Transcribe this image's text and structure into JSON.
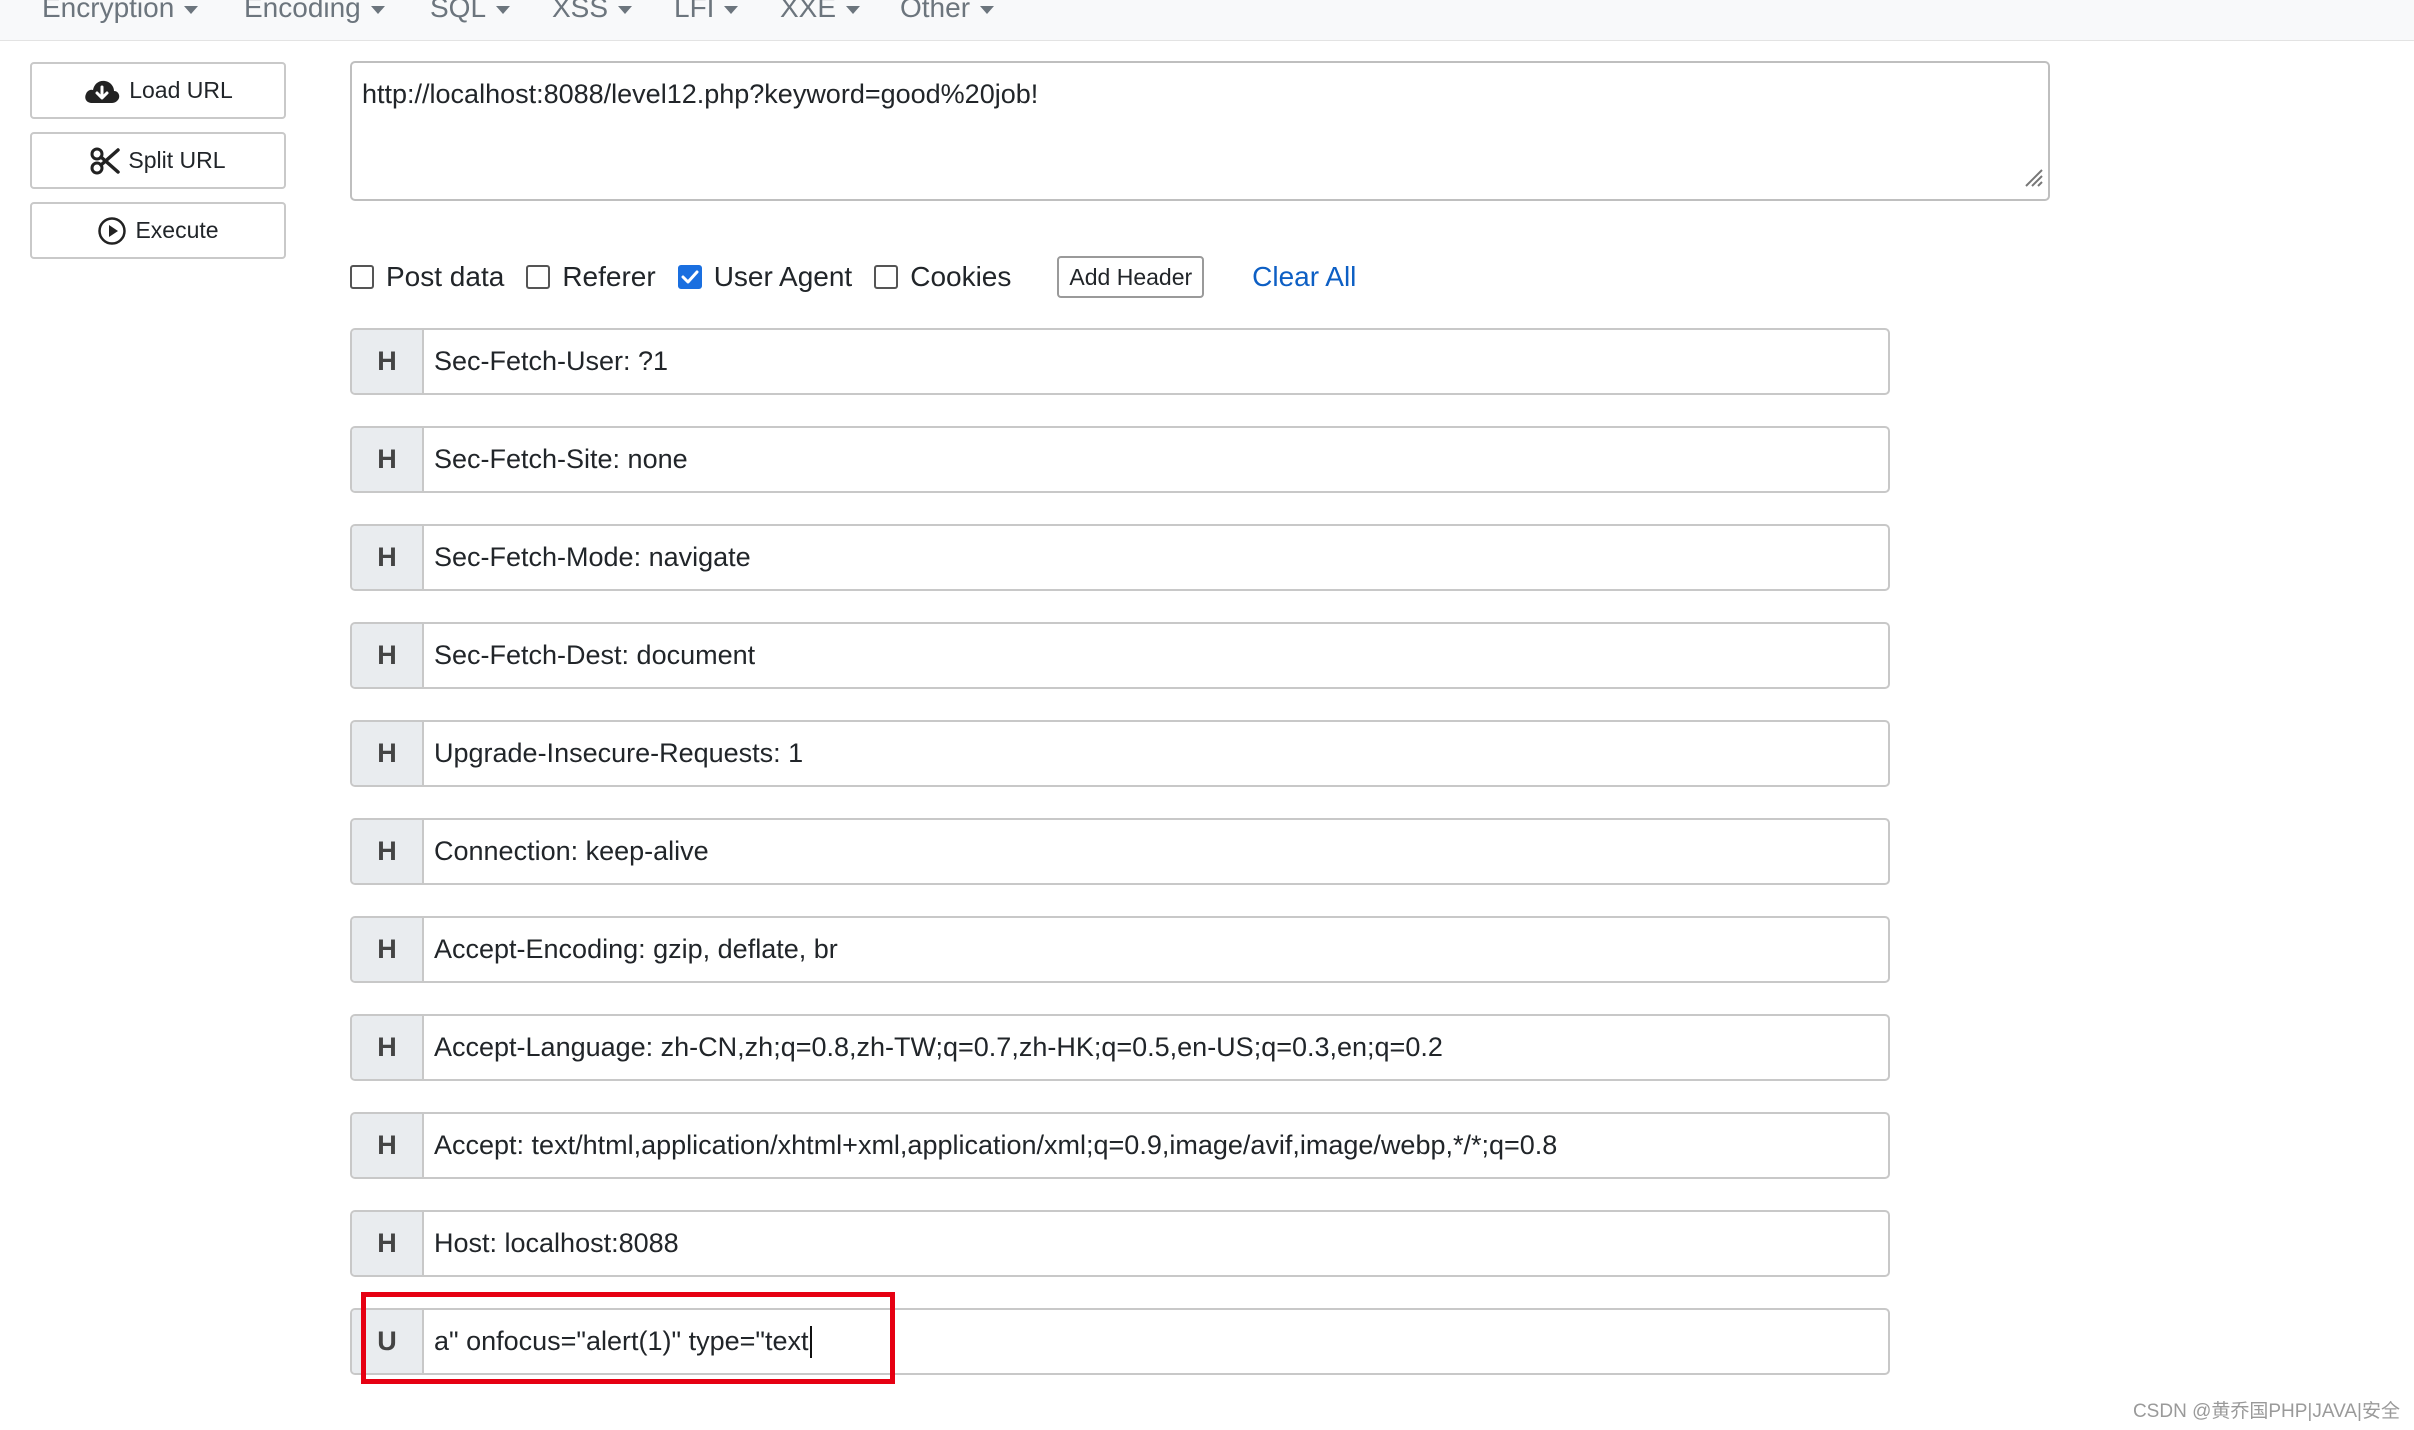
{
  "menu": [
    {
      "label": "Encryption"
    },
    {
      "label": "Encoding"
    },
    {
      "label": "SQL"
    },
    {
      "label": "XSS"
    },
    {
      "label": "LFI"
    },
    {
      "label": "XXE"
    },
    {
      "label": "Other"
    }
  ],
  "sidebar": {
    "load_url": "Load URL",
    "split_url": "Split URL",
    "execute": "Execute"
  },
  "url": {
    "value": "http://localhost:8088/level12.php?keyword=good%20job!"
  },
  "options": {
    "post_data": {
      "label": "Post data",
      "checked": false
    },
    "referer": {
      "label": "Referer",
      "checked": false
    },
    "user_agent": {
      "label": "User Agent",
      "checked": true
    },
    "cookies": {
      "label": "Cookies",
      "checked": false
    },
    "add_header": "Add Header",
    "clear_all": "Clear All"
  },
  "headers": [
    {
      "tag": "H",
      "value": "Sec-Fetch-User: ?1"
    },
    {
      "tag": "H",
      "value": "Sec-Fetch-Site: none"
    },
    {
      "tag": "H",
      "value": "Sec-Fetch-Mode: navigate"
    },
    {
      "tag": "H",
      "value": "Sec-Fetch-Dest: document"
    },
    {
      "tag": "H",
      "value": "Upgrade-Insecure-Requests: 1"
    },
    {
      "tag": "H",
      "value": "Connection: keep-alive"
    },
    {
      "tag": "H",
      "value": "Accept-Encoding: gzip, deflate, br"
    },
    {
      "tag": "H",
      "value": "Accept-Language: zh-CN,zh;q=0.8,zh-TW;q=0.7,zh-HK;q=0.5,en-US;q=0.3,en;q=0.2"
    },
    {
      "tag": "H",
      "value": "Accept: text/html,application/xhtml+xml,application/xml;q=0.9,image/avif,image/webp,*/*;q=0.8"
    },
    {
      "tag": "H",
      "value": "Host: localhost:8088"
    },
    {
      "tag": "U",
      "value": "a\" onfocus=\"alert(1)\" type=\"text"
    }
  ],
  "watermark": "CSDN @黄乔国PHP|JAVA|安全",
  "colors": {
    "accent": "#1a6fe0",
    "link": "#0d5fc4",
    "highlight": "#e60012"
  }
}
